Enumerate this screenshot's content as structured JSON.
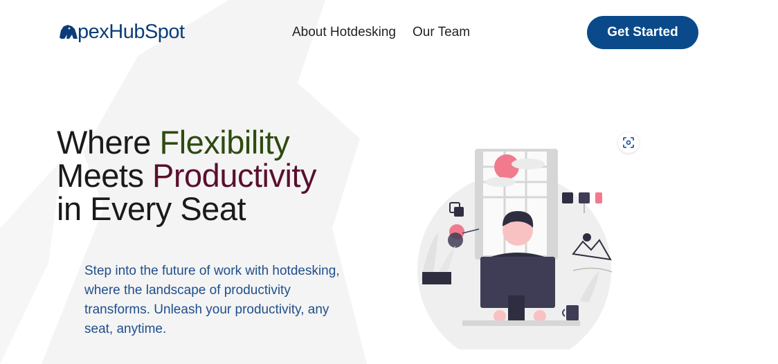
{
  "header": {
    "logo_text": "pexHubSpot",
    "logo_icon": "gorilla-logo-icon",
    "nav": [
      {
        "label": "About Hotdesking"
      },
      {
        "label": "Our Team"
      }
    ],
    "cta_label": "Get Started"
  },
  "hero": {
    "headline_part1": "Where ",
    "headline_accent1": "Flexibility",
    "headline_part2": "Meets ",
    "headline_accent2": "Productivity",
    "headline_part3": "in Every Seat",
    "subtext": "Step into the future of work with hotdesking, where the landscape of productivity transforms. Unleash your productivity, any seat, anytime.",
    "illustration_icon": "person-at-computer-illustration"
  },
  "colors": {
    "brand": "#0a4a8a",
    "logo": "#0b3d78",
    "accent_green": "#2e4a10",
    "accent_maroon": "#5a0f2e",
    "subtext": "#1f4e8c",
    "pink": "#f27a8d"
  }
}
